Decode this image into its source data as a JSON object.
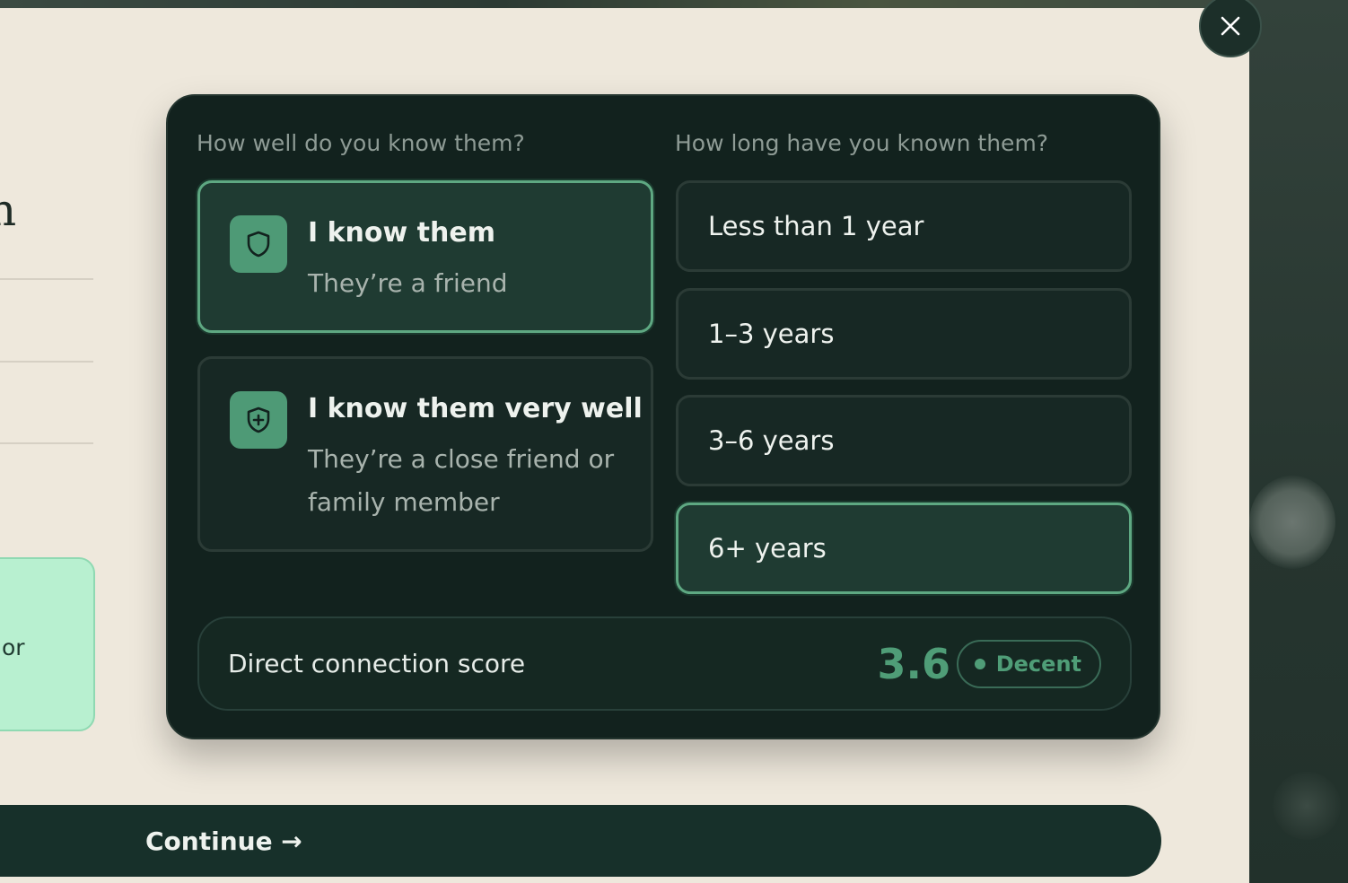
{
  "background_card": {
    "text": "or"
  },
  "panel": {
    "familiarity": {
      "question": "How well do you know them?",
      "options": [
        {
          "title": "I know them",
          "subtitle": "They’re a friend",
          "icon": "shield-icon",
          "selected": true
        },
        {
          "title": "I know them very well",
          "subtitle": "They’re a close friend or family member",
          "icon": "shield-plus-icon",
          "selected": false
        }
      ]
    },
    "duration": {
      "question": "How long have you known them?",
      "options": [
        {
          "label": "Less than 1 year",
          "selected": false
        },
        {
          "label": "1–3 years",
          "selected": false
        },
        {
          "label": "3–6 years",
          "selected": false
        },
        {
          "label": "6+ years",
          "selected": true
        }
      ]
    },
    "score": {
      "label": "Direct connection score",
      "value": "3.6",
      "rating": "Decent"
    }
  },
  "continue_button": {
    "label": "Continue →"
  },
  "colors": {
    "accent": "#4f9d77",
    "panel_bg": "#12221e",
    "sheet_bg": "#eee8dc",
    "selected_border": "#5ea882"
  }
}
